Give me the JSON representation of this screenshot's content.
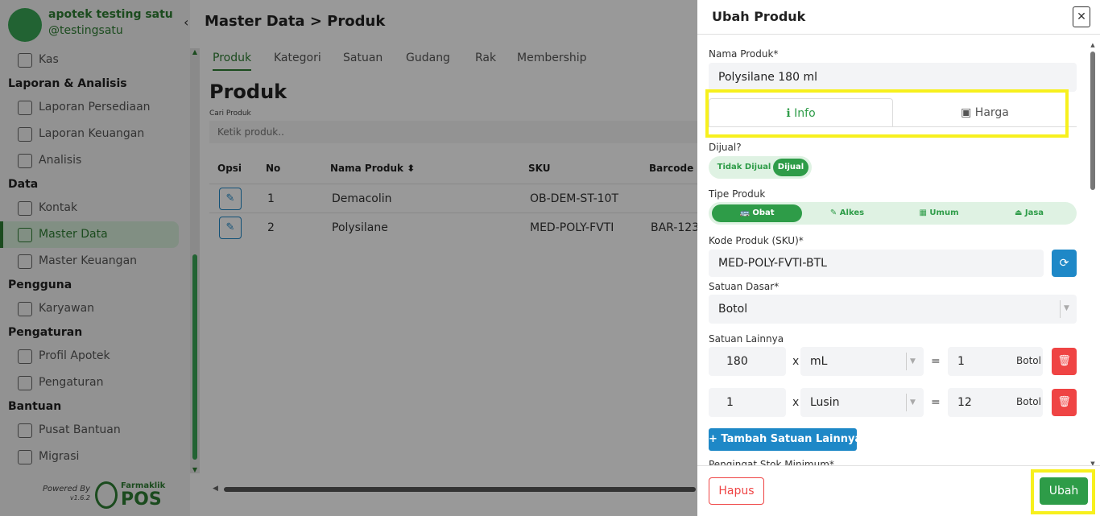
{
  "sidebar": {
    "app_name": "apotek testing satu",
    "handle": "@testingsatu",
    "collapse_icon": "‹",
    "items": [
      {
        "type": "item",
        "label": "Kas",
        "icon": "cash-icon"
      },
      {
        "type": "section",
        "label": "Laporan & Analisis"
      },
      {
        "type": "item",
        "label": "Laporan Persediaan",
        "icon": "clipboard-icon"
      },
      {
        "type": "item",
        "label": "Laporan Keuangan",
        "icon": "clipboard-icon"
      },
      {
        "type": "item",
        "label": "Analisis",
        "icon": "activity-icon"
      },
      {
        "type": "section",
        "label": "Data"
      },
      {
        "type": "item",
        "label": "Kontak",
        "icon": "book-icon"
      },
      {
        "type": "item",
        "label": "Master Data",
        "icon": "database-icon",
        "active": true
      },
      {
        "type": "item",
        "label": "Master Keuangan",
        "icon": "wallet-icon"
      },
      {
        "type": "section",
        "label": "Pengguna"
      },
      {
        "type": "item",
        "label": "Karyawan",
        "icon": "users-icon"
      },
      {
        "type": "section",
        "label": "Pengaturan"
      },
      {
        "type": "item",
        "label": "Profil Apotek",
        "icon": "store-icon"
      },
      {
        "type": "item",
        "label": "Pengaturan",
        "icon": "gear-icon"
      },
      {
        "type": "section",
        "label": "Bantuan"
      },
      {
        "type": "item",
        "label": "Pusat Bantuan",
        "icon": "hand-icon"
      },
      {
        "type": "item",
        "label": "Migrasi",
        "icon": "migrate-icon"
      }
    ],
    "powered_by": "Powered By",
    "version": "v1.6.2",
    "brand_small": "Farmaklik",
    "brand_big": "POS"
  },
  "main": {
    "breadcrumb": "Master Data > Produk",
    "tabs": [
      "Produk",
      "Kategori",
      "Satuan",
      "Gudang",
      "Rak",
      "Membership"
    ],
    "heading": "Produk",
    "search_label": "Cari Produk",
    "search_placeholder": "Ketik produk..",
    "table": {
      "headers": [
        "Opsi",
        "No",
        "Nama Produk",
        "SKU",
        "Barcode"
      ],
      "sort_icon": "⬍",
      "rows": [
        {
          "no": "1",
          "name": "Demacolin",
          "sku": "OB-DEM-ST-10T",
          "barcode": ""
        },
        {
          "no": "2",
          "name": "Polysilane",
          "sku": "MED-POLY-FVTI",
          "barcode": "BAR-123"
        }
      ]
    }
  },
  "drawer": {
    "title": "Ubah Produk",
    "close_icon": "✕",
    "nama_label": "Nama Produk*",
    "nama_value": "Polysilane 180 ml",
    "tabs": {
      "info": "Info",
      "harga": "Harga",
      "info_icon": "ℹ",
      "harga_icon": "▣"
    },
    "dijual_label": "Dijual?",
    "dijual_options": [
      "Tidak Dijual",
      "Dijual"
    ],
    "tipe_label": "Tipe Produk",
    "tipe_options": [
      "🚌 Obat",
      "✎ Alkes",
      "▦ Umum",
      "⏏ Jasa"
    ],
    "sku_label": "Kode Produk (SKU)*",
    "sku_value": "MED-POLY-FVTI-BTL",
    "sync_icon": "⟳",
    "satuan_label": "Satuan Dasar*",
    "satuan_value": "Botol",
    "satuan_lain_label": "Satuan Lainnya",
    "conversions": [
      {
        "qty": "180",
        "unit": "mL",
        "result": "1",
        "base": "Botol"
      },
      {
        "qty": "1",
        "unit": "Lusin",
        "result": "12",
        "base": "Botol"
      }
    ],
    "times": "x",
    "equals": "=",
    "delete_icon": "🗑",
    "add_button": "+ Tambah Satuan Lainnya",
    "cutoff_label": "Pengingat Stok Minimum*",
    "hapus": "Hapus",
    "ubah": "Ubah"
  },
  "colors": {
    "primary_green": "#2e9c48",
    "blue": "#1e88c7",
    "red": "#ef4444",
    "highlight": "#f7f01d"
  }
}
